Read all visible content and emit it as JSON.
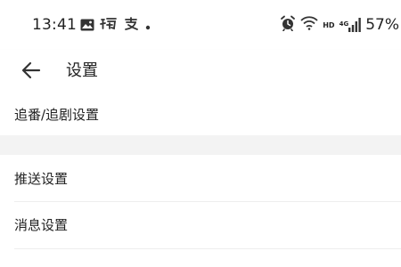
{
  "status_bar": {
    "time": "13:41",
    "left_icons": [
      "image-icon",
      "taobao-icon",
      "alipay-icon",
      "dot-icon"
    ],
    "right_icons": [
      "alarm-icon",
      "wifi-icon",
      "hd-icon",
      "signal-4g-icon",
      "battery-icon"
    ],
    "hd_label": "HD",
    "network_label": "4G",
    "battery": "57%"
  },
  "app_bar": {
    "back_icon": "arrow-left-icon",
    "title": "设置"
  },
  "settings": {
    "items": [
      {
        "label": "追番/追剧设置"
      },
      {
        "label": "推送设置"
      },
      {
        "label": "消息设置"
      }
    ]
  },
  "colors": {
    "background": "#ffffff",
    "section_gap": "#f3f3f3",
    "divider": "#eeeeee",
    "text": "#222222"
  }
}
